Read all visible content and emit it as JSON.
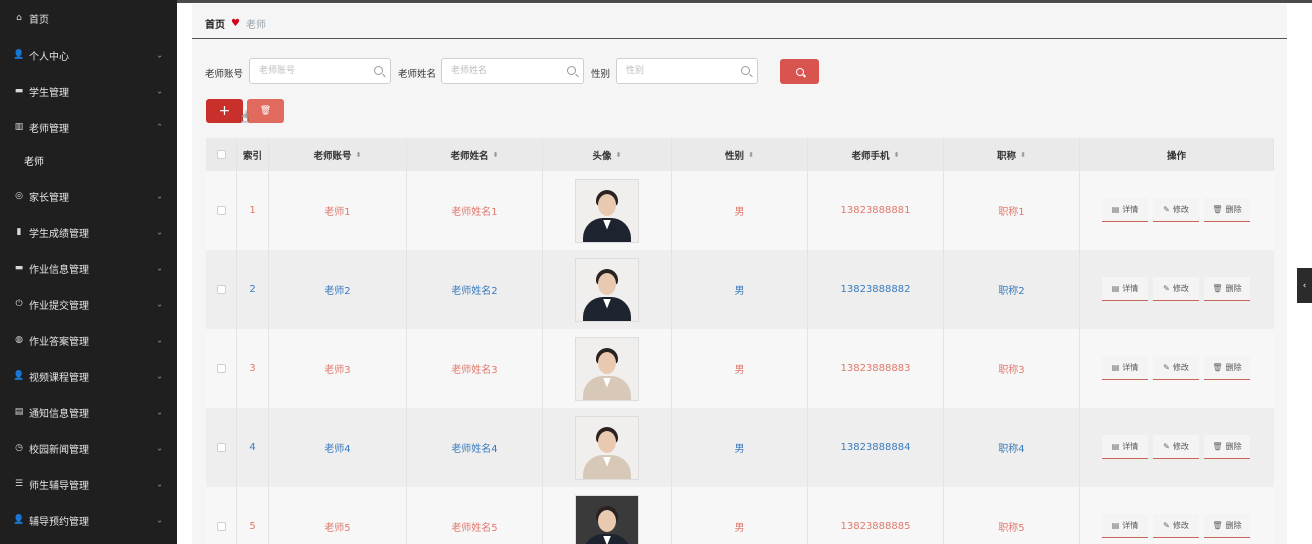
{
  "sidebar": {
    "items": [
      {
        "label": "首页",
        "icon": "home-icon",
        "glyph": "⌂",
        "chevron": ""
      },
      {
        "label": "个人中心",
        "icon": "user-icon",
        "glyph": "👤",
        "chevron": "⌄"
      },
      {
        "label": "学生管理",
        "icon": "card-icon",
        "glyph": "▬",
        "chevron": "⌄"
      },
      {
        "label": "老师管理",
        "icon": "chart-icon",
        "glyph": "▥",
        "chevron": "⌃"
      },
      {
        "label": "家长管理",
        "icon": "compass-icon",
        "glyph": "◎",
        "chevron": "⌄"
      },
      {
        "label": "学生成绩管理",
        "icon": "bar-chart-icon",
        "glyph": "▮",
        "chevron": "⌄"
      },
      {
        "label": "作业信息管理",
        "icon": "message-icon",
        "glyph": "▬",
        "chevron": "⌄"
      },
      {
        "label": "作业提交管理",
        "icon": "power-icon",
        "glyph": "⏻",
        "chevron": "⌄"
      },
      {
        "label": "作业答案管理",
        "icon": "globe-icon",
        "glyph": "◍",
        "chevron": "⌄"
      },
      {
        "label": "视频课程管理",
        "icon": "user-icon",
        "glyph": "👤",
        "chevron": "⌄"
      },
      {
        "label": "通知信息管理",
        "icon": "inbox-icon",
        "glyph": "▤",
        "chevron": "⌄"
      },
      {
        "label": "校园新闻管理",
        "icon": "clock-icon",
        "glyph": "◷",
        "chevron": "⌄"
      },
      {
        "label": "师生辅导管理",
        "icon": "sliders-icon",
        "glyph": "☰",
        "chevron": "⌄"
      },
      {
        "label": "辅导预约管理",
        "icon": "user-icon",
        "glyph": "👤",
        "chevron": "⌄"
      }
    ],
    "sub_item": "老师"
  },
  "breadcrumb": {
    "home": "首页",
    "current": "老师"
  },
  "search": {
    "account_label": "老师账号",
    "account_placeholder": "老师账号",
    "name_label": "老师姓名",
    "name_placeholder": "老师姓名",
    "gender_label": "性别",
    "gender_placeholder": "性别"
  },
  "buttons": {
    "add": "+",
    "delete_glyph": "🗑"
  },
  "table": {
    "headers": [
      "索引",
      "老师账号",
      "老师姓名",
      "头像",
      "性别",
      "老师手机",
      "职称",
      "操作"
    ],
    "sort_glyph": "⬍",
    "rows": [
      {
        "index": "1",
        "account": "老师1",
        "name": "老师姓名1",
        "gender": "男",
        "phone": "13823888881",
        "title": "职称1",
        "color": "#e07a6e",
        "photo": "portrait-female"
      },
      {
        "index": "2",
        "account": "老师2",
        "name": "老师姓名2",
        "gender": "男",
        "phone": "13823888882",
        "title": "职称2",
        "color": "#3a7bbf",
        "photo": "portrait-female"
      },
      {
        "index": "3",
        "account": "老师3",
        "name": "老师姓名3",
        "gender": "男",
        "phone": "13823888883",
        "title": "职称3",
        "color": "#e07a6e",
        "photo": "portrait-female"
      },
      {
        "index": "4",
        "account": "老师4",
        "name": "老师姓名4",
        "gender": "男",
        "phone": "13823888884",
        "title": "职称4",
        "color": "#3a7bbf",
        "photo": "portrait-female"
      },
      {
        "index": "5",
        "account": "老师5",
        "name": "老师姓名5",
        "gender": "男",
        "phone": "13823888885",
        "title": "职称5",
        "color": "#e07a6e",
        "photo": "portrait-male"
      }
    ],
    "actions": {
      "detail": "详情",
      "edit": "修改",
      "delete": "删除"
    }
  },
  "colors": {
    "sidebar_bg": "#1f1f1f",
    "accent_red": "#d9534f",
    "row_alt": "#eeeeee"
  }
}
